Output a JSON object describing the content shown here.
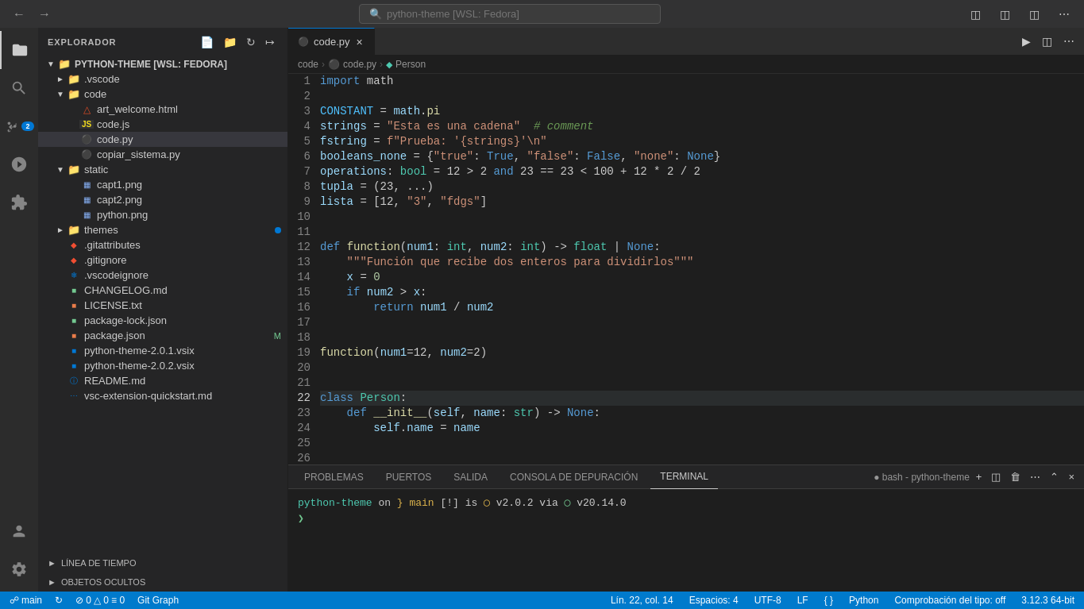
{
  "titlebar": {
    "search_placeholder": "python-theme [WSL: Fedora]",
    "nav_back": "←",
    "nav_forward": "→"
  },
  "sidebar": {
    "header": "EXPLORADOR",
    "root": "PYTHON-THEME [WSL: FEDORA]",
    "items": [
      {
        "id": "vscode",
        "name": ".vscode",
        "type": "folder",
        "indent": 1,
        "collapsed": true
      },
      {
        "id": "code",
        "name": "code",
        "type": "folder",
        "indent": 1,
        "collapsed": false
      },
      {
        "id": "art_welcome",
        "name": "art_welcome.html",
        "type": "html",
        "indent": 2
      },
      {
        "id": "code_js",
        "name": "code.js",
        "type": "js",
        "indent": 2
      },
      {
        "id": "code_py",
        "name": "code.py",
        "type": "py",
        "indent": 2,
        "selected": true
      },
      {
        "id": "copiar_sistema",
        "name": "copiar_sistema.py",
        "type": "py",
        "indent": 2
      },
      {
        "id": "static",
        "name": "static",
        "type": "folder",
        "indent": 1,
        "collapsed": false
      },
      {
        "id": "capt1",
        "name": "capt1.png",
        "type": "png",
        "indent": 2
      },
      {
        "id": "capt2",
        "name": "capt2.png",
        "type": "png",
        "indent": 2
      },
      {
        "id": "python_png",
        "name": "python.png",
        "type": "png",
        "indent": 2
      },
      {
        "id": "themes",
        "name": "themes",
        "type": "folder-green",
        "indent": 1,
        "collapsed": true,
        "dot": true
      },
      {
        "id": "gitattributes",
        "name": ".gitattributes",
        "type": "git",
        "indent": 1
      },
      {
        "id": "gitignore",
        "name": ".gitignore",
        "type": "git",
        "indent": 1
      },
      {
        "id": "vscodeignore",
        "name": ".vscodeignore",
        "type": "vs",
        "indent": 1
      },
      {
        "id": "changelog",
        "name": "CHANGELOG.md",
        "type": "md",
        "indent": 1
      },
      {
        "id": "license",
        "name": "LICENSE.txt",
        "type": "txt",
        "indent": 1
      },
      {
        "id": "package_lock",
        "name": "package-lock.json",
        "type": "json",
        "indent": 1
      },
      {
        "id": "package_json",
        "name": "package.json",
        "type": "json-npm",
        "indent": 1,
        "badge": "M"
      },
      {
        "id": "python_theme_201",
        "name": "python-theme-2.0.1.vsix",
        "type": "vsix",
        "indent": 1
      },
      {
        "id": "python_theme_202",
        "name": "python-theme-2.0.2.vsix",
        "type": "vsix",
        "indent": 1
      },
      {
        "id": "readme",
        "name": "README.md",
        "type": "readme",
        "indent": 1
      },
      {
        "id": "vsc_quickstart",
        "name": "vsc-extension-quickstart.md",
        "type": "md2",
        "indent": 1
      }
    ],
    "collapsibles": [
      {
        "label": "LÍNEA DE TIEMPO"
      },
      {
        "label": "OBJETOS OCULTOS"
      }
    ]
  },
  "tabs": [
    {
      "label": "code.py",
      "active": true,
      "icon": "py"
    }
  ],
  "breadcrumb": {
    "parts": [
      "code",
      "code.py",
      "Person"
    ]
  },
  "code": {
    "lines": [
      {
        "n": 1,
        "tokens": [
          {
            "t": "kw",
            "v": "import"
          },
          {
            "t": "op",
            "v": " math"
          }
        ]
      },
      {
        "n": 2,
        "tokens": []
      },
      {
        "n": 3,
        "tokens": [
          {
            "t": "var",
            "v": "CONSTANT"
          },
          {
            "t": "op",
            "v": " = "
          },
          {
            "t": "var",
            "v": "math"
          },
          {
            "t": "op",
            "v": "."
          },
          {
            "t": "fn",
            "v": "pi"
          }
        ]
      },
      {
        "n": 4,
        "tokens": [
          {
            "t": "var",
            "v": "strings"
          },
          {
            "t": "op",
            "v": " = "
          },
          {
            "t": "str",
            "v": "\"Esta es una cadena\""
          },
          {
            "t": "op",
            "v": "  "
          },
          {
            "t": "cmt",
            "v": "# comment"
          }
        ]
      },
      {
        "n": 5,
        "tokens": [
          {
            "t": "var",
            "v": "fstring"
          },
          {
            "t": "op",
            "v": " = "
          },
          {
            "t": "str",
            "v": "f\"Prueba: '{strings}'\\n\""
          }
        ]
      },
      {
        "n": 6,
        "tokens": [
          {
            "t": "var",
            "v": "booleans_none"
          },
          {
            "t": "op",
            "v": " = {"
          },
          {
            "t": "str",
            "v": "\"true\""
          },
          {
            "t": "op",
            "v": ": "
          },
          {
            "t": "bool-val",
            "v": "True"
          },
          {
            "t": "op",
            "v": ", "
          },
          {
            "t": "str",
            "v": "\"false\""
          },
          {
            "t": "op",
            "v": ": "
          },
          {
            "t": "bool-val",
            "v": "False"
          },
          {
            "t": "op",
            "v": ", "
          },
          {
            "t": "str",
            "v": "\"none\""
          },
          {
            "t": "op",
            "v": ": "
          },
          {
            "t": "none-val",
            "v": "None"
          },
          {
            "t": "op",
            "v": "}"
          }
        ]
      },
      {
        "n": 7,
        "tokens": [
          {
            "t": "var",
            "v": "operations"
          },
          {
            "t": "op",
            "v": ": "
          },
          {
            "t": "type",
            "v": "bool"
          },
          {
            "t": "op",
            "v": " = 12 > 2 "
          },
          {
            "t": "kw",
            "v": "and"
          },
          {
            "t": "op",
            "v": " 23 == 23 < 100 + 12 * 2 / 2"
          }
        ]
      },
      {
        "n": 8,
        "tokens": [
          {
            "t": "var",
            "v": "tupla"
          },
          {
            "t": "op",
            "v": " = (23, ...)"
          }
        ]
      },
      {
        "n": 9,
        "tokens": [
          {
            "t": "var",
            "v": "lista"
          },
          {
            "t": "op",
            "v": " = [12, "
          },
          {
            "t": "str",
            "v": "\"3\""
          },
          {
            "t": "op",
            "v": ", "
          },
          {
            "t": "str",
            "v": "\"fdgs\""
          },
          {
            "t": "op",
            "v": "]"
          }
        ]
      },
      {
        "n": 10,
        "tokens": []
      },
      {
        "n": 11,
        "tokens": []
      },
      {
        "n": 12,
        "tokens": [
          {
            "t": "kw",
            "v": "def"
          },
          {
            "t": "op",
            "v": " "
          },
          {
            "t": "fn",
            "v": "function"
          },
          {
            "t": "op",
            "v": "("
          },
          {
            "t": "param",
            "v": "num1"
          },
          {
            "t": "op",
            "v": ": "
          },
          {
            "t": "type",
            "v": "int"
          },
          {
            "t": "op",
            "v": ", "
          },
          {
            "t": "param",
            "v": "num2"
          },
          {
            "t": "op",
            "v": ": "
          },
          {
            "t": "type",
            "v": "int"
          },
          {
            "t": "op",
            "v": ") -> "
          },
          {
            "t": "type",
            "v": "float"
          },
          {
            "t": "op",
            "v": " | "
          },
          {
            "t": "none-val",
            "v": "None"
          },
          {
            "t": "op",
            "v": ":"
          }
        ]
      },
      {
        "n": 13,
        "tokens": [
          {
            "t": "op",
            "v": "    "
          },
          {
            "t": "str",
            "v": "\"\"\"Función que recibe dos enteros para dividirlos\"\"\""
          }
        ]
      },
      {
        "n": 14,
        "tokens": [
          {
            "t": "op",
            "v": "    "
          },
          {
            "t": "var",
            "v": "x"
          },
          {
            "t": "op",
            "v": " = "
          },
          {
            "t": "num",
            "v": "0"
          }
        ]
      },
      {
        "n": 15,
        "tokens": [
          {
            "t": "op",
            "v": "    "
          },
          {
            "t": "kw",
            "v": "if"
          },
          {
            "t": "op",
            "v": " "
          },
          {
            "t": "var",
            "v": "num2"
          },
          {
            "t": "op",
            "v": " > "
          },
          {
            "t": "var",
            "v": "x"
          },
          {
            "t": "op",
            "v": ":"
          }
        ]
      },
      {
        "n": 16,
        "tokens": [
          {
            "t": "op",
            "v": "        "
          },
          {
            "t": "kw",
            "v": "return"
          },
          {
            "t": "op",
            "v": " "
          },
          {
            "t": "var",
            "v": "num1"
          },
          {
            "t": "op",
            "v": " / "
          },
          {
            "t": "var",
            "v": "num2"
          }
        ]
      },
      {
        "n": 17,
        "tokens": []
      },
      {
        "n": 18,
        "tokens": []
      },
      {
        "n": 19,
        "tokens": [
          {
            "t": "fn",
            "v": "function"
          },
          {
            "t": "op",
            "v": "("
          },
          {
            "t": "param",
            "v": "num1"
          },
          {
            "t": "op",
            "v": "=12, "
          },
          {
            "t": "param",
            "v": "num2"
          },
          {
            "t": "op",
            "v": "=2)"
          }
        ]
      },
      {
        "n": 20,
        "tokens": []
      },
      {
        "n": 21,
        "tokens": []
      },
      {
        "n": 22,
        "tokens": [
          {
            "t": "kw",
            "v": "class"
          },
          {
            "t": "op",
            "v": " "
          },
          {
            "t": "cls",
            "v": "Person"
          },
          {
            "t": "op",
            "v": ":"
          }
        ],
        "highlighted": true
      },
      {
        "n": 23,
        "tokens": [
          {
            "t": "op",
            "v": "    "
          },
          {
            "t": "kw",
            "v": "def"
          },
          {
            "t": "op",
            "v": " "
          },
          {
            "t": "fn",
            "v": "__init__"
          },
          {
            "t": "op",
            "v": "("
          },
          {
            "t": "param",
            "v": "self"
          },
          {
            "t": "op",
            "v": ", "
          },
          {
            "t": "param",
            "v": "name"
          },
          {
            "t": "op",
            "v": ": "
          },
          {
            "t": "type",
            "v": "str"
          },
          {
            "t": "op",
            "v": ") -> "
          },
          {
            "t": "none-val",
            "v": "None"
          },
          {
            "t": "op",
            "v": ":"
          }
        ]
      },
      {
        "n": 24,
        "tokens": [
          {
            "t": "op",
            "v": "        "
          },
          {
            "t": "var",
            "v": "self"
          },
          {
            "t": "op",
            "v": "."
          },
          {
            "t": "var",
            "v": "name"
          },
          {
            "t": "op",
            "v": " = "
          },
          {
            "t": "var",
            "v": "name"
          }
        ]
      },
      {
        "n": 25,
        "tokens": []
      },
      {
        "n": 26,
        "tokens": []
      }
    ]
  },
  "panel": {
    "tabs": [
      "PROBLEMAS",
      "PUERTOS",
      "SALIDA",
      "CONSOLA DE DEPURACIÓN",
      "TERMINAL"
    ],
    "active_tab": "TERMINAL",
    "terminal_title": "bash - python-theme",
    "terminal_lines": [
      {
        "text": "python-theme on  main [!] is  v2.0.2 via  v20.14.0"
      },
      {
        "text": "❯"
      }
    ]
  },
  "status_bar": {
    "git_branch": " main",
    "errors": "⊘ 0",
    "warnings": "△ 0",
    "info": "≡ 0",
    "line_col": "Lín. 22, col. 14",
    "spaces": "Espacios: 4",
    "encoding": "UTF-8",
    "eol": "LF",
    "language": "Python",
    "type_check": "Comprobación del tipo: off",
    "version": "3.12.3 64-bit"
  }
}
